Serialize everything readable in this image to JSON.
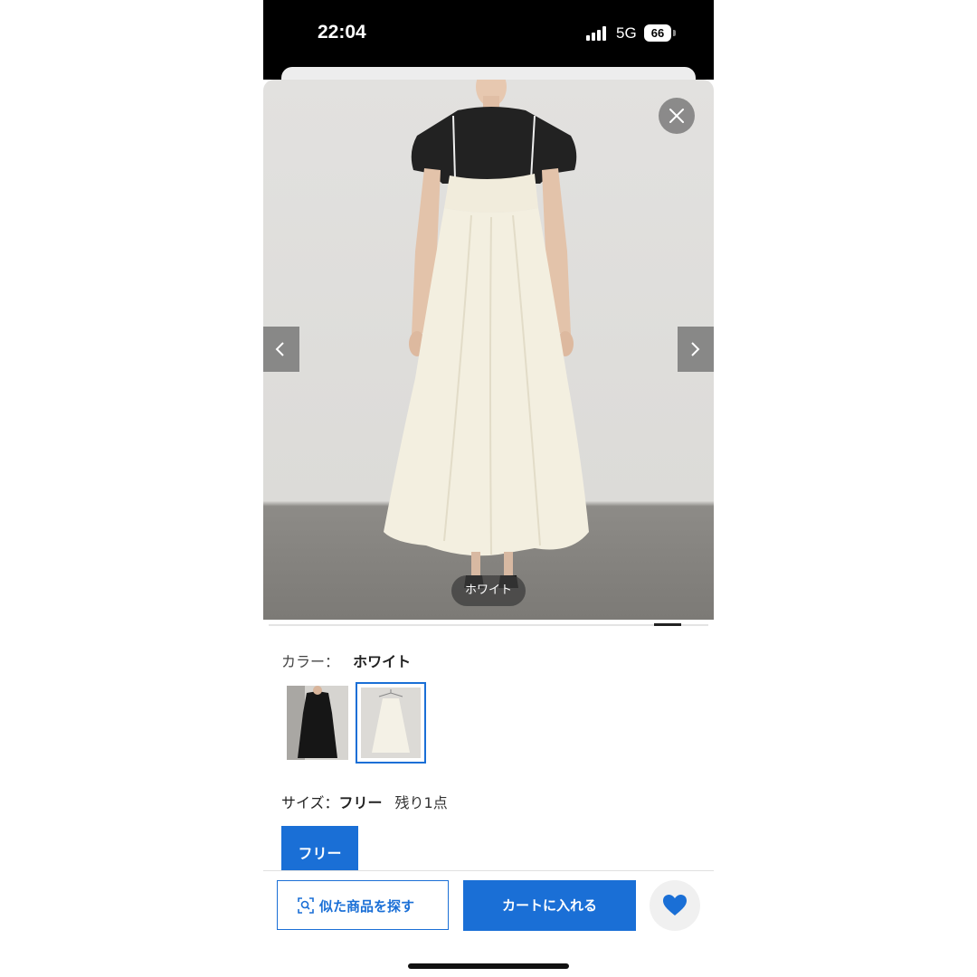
{
  "status_bar": {
    "time": "22:04",
    "network": "5G",
    "battery": "66"
  },
  "gallery": {
    "color_chip": "ホワイト"
  },
  "color": {
    "label": "カラー：",
    "selected": "ホワイト"
  },
  "size": {
    "label": "サイズ：",
    "selected": "フリー",
    "stock": "残り1点",
    "button_label": "フリー"
  },
  "actions": {
    "similar_label": "似た商品を探す",
    "cart_label": "カートに入れる"
  },
  "colors": {
    "accent": "#1a6fd6",
    "dress": "#f3efe0",
    "tshirt": "#222222"
  }
}
